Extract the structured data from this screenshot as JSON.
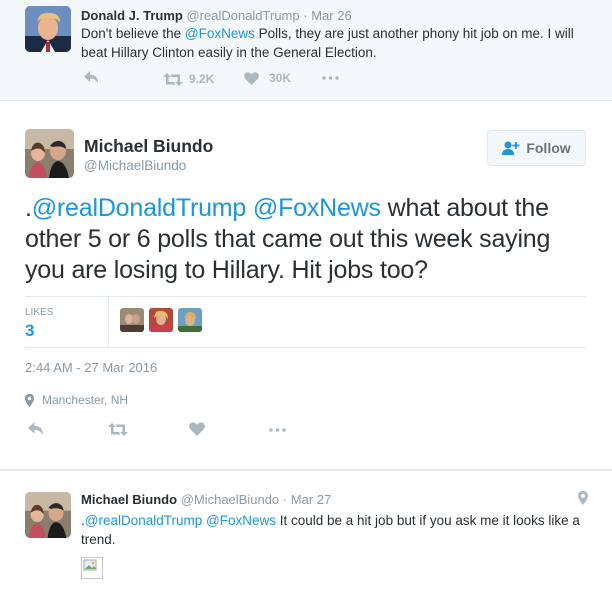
{
  "parent_tweet": {
    "fullname": "Donald J. Trump",
    "username": "@realDonaldTrump",
    "separator": "·",
    "time": "Mar 26",
    "text_1": "Don't believe the ",
    "mention": "@FoxNews",
    "text_2": " Polls, they are just another phony hit job on me. I will beat Hillary Clinton easily in the General Election.",
    "retweets": "9.2K",
    "likes": "30K",
    "icons": [
      "reply-icon",
      "retweet-icon",
      "heart-icon",
      "more-icon"
    ]
  },
  "main_tweet": {
    "fullname": "Michael Biundo",
    "username": "@MichaelBiundo",
    "follow_label": "Follow",
    "text_prefix": ".",
    "mention_1": "@realDonaldTrump",
    "mention_2": "@FoxNews",
    "text_rest": " what about the other 5 or 6 polls that came out this week saying you are losing to Hillary. Hit jobs too?",
    "likes_label": "LIKES",
    "likes_count": "3",
    "timestamp": "2:44 AM - 27 Mar 2016",
    "location": "Manchester, NH",
    "icons": [
      "reply-icon",
      "retweet-icon",
      "heart-icon",
      "more-icon",
      "location-pin-icon",
      "follow-icon"
    ]
  },
  "reply_tweet": {
    "fullname": "Michael Biundo",
    "username": "@MichaelBiundo",
    "separator": "·",
    "time": "Mar 27",
    "text_prefix": ".",
    "mention_1": "@realDonaldTrump",
    "mention_2": "@FoxNews",
    "text_rest": " It could be a hit job but if you ask me it looks like a trend.",
    "icons": [
      "location-pin-icon",
      "broken-image-icon"
    ]
  },
  "colors": {
    "link": "#1b95e0",
    "text": "#292f33",
    "muted": "#8899a6",
    "icon": "#aab8c2",
    "parent_bg": "#f5f8fa",
    "border": "#e1e8ed"
  }
}
